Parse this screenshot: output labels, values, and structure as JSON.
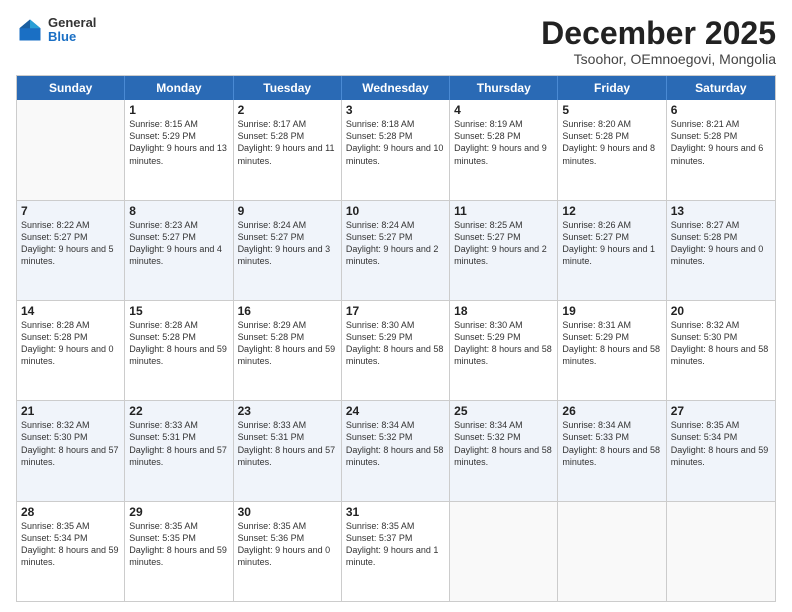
{
  "logo": {
    "general": "General",
    "blue": "Blue"
  },
  "title": "December 2025",
  "subtitle": "Tsoohor, OEmnoegovi, Mongolia",
  "header_days": [
    "Sunday",
    "Monday",
    "Tuesday",
    "Wednesday",
    "Thursday",
    "Friday",
    "Saturday"
  ],
  "weeks": [
    [
      {
        "day": "",
        "sunrise": "",
        "sunset": "",
        "daylight": ""
      },
      {
        "day": "1",
        "sunrise": "Sunrise: 8:15 AM",
        "sunset": "Sunset: 5:29 PM",
        "daylight": "Daylight: 9 hours and 13 minutes."
      },
      {
        "day": "2",
        "sunrise": "Sunrise: 8:17 AM",
        "sunset": "Sunset: 5:28 PM",
        "daylight": "Daylight: 9 hours and 11 minutes."
      },
      {
        "day": "3",
        "sunrise": "Sunrise: 8:18 AM",
        "sunset": "Sunset: 5:28 PM",
        "daylight": "Daylight: 9 hours and 10 minutes."
      },
      {
        "day": "4",
        "sunrise": "Sunrise: 8:19 AM",
        "sunset": "Sunset: 5:28 PM",
        "daylight": "Daylight: 9 hours and 9 minutes."
      },
      {
        "day": "5",
        "sunrise": "Sunrise: 8:20 AM",
        "sunset": "Sunset: 5:28 PM",
        "daylight": "Daylight: 9 hours and 8 minutes."
      },
      {
        "day": "6",
        "sunrise": "Sunrise: 8:21 AM",
        "sunset": "Sunset: 5:28 PM",
        "daylight": "Daylight: 9 hours and 6 minutes."
      }
    ],
    [
      {
        "day": "7",
        "sunrise": "Sunrise: 8:22 AM",
        "sunset": "Sunset: 5:27 PM",
        "daylight": "Daylight: 9 hours and 5 minutes."
      },
      {
        "day": "8",
        "sunrise": "Sunrise: 8:23 AM",
        "sunset": "Sunset: 5:27 PM",
        "daylight": "Daylight: 9 hours and 4 minutes."
      },
      {
        "day": "9",
        "sunrise": "Sunrise: 8:24 AM",
        "sunset": "Sunset: 5:27 PM",
        "daylight": "Daylight: 9 hours and 3 minutes."
      },
      {
        "day": "10",
        "sunrise": "Sunrise: 8:24 AM",
        "sunset": "Sunset: 5:27 PM",
        "daylight": "Daylight: 9 hours and 2 minutes."
      },
      {
        "day": "11",
        "sunrise": "Sunrise: 8:25 AM",
        "sunset": "Sunset: 5:27 PM",
        "daylight": "Daylight: 9 hours and 2 minutes."
      },
      {
        "day": "12",
        "sunrise": "Sunrise: 8:26 AM",
        "sunset": "Sunset: 5:27 PM",
        "daylight": "Daylight: 9 hours and 1 minute."
      },
      {
        "day": "13",
        "sunrise": "Sunrise: 8:27 AM",
        "sunset": "Sunset: 5:28 PM",
        "daylight": "Daylight: 9 hours and 0 minutes."
      }
    ],
    [
      {
        "day": "14",
        "sunrise": "Sunrise: 8:28 AM",
        "sunset": "Sunset: 5:28 PM",
        "daylight": "Daylight: 9 hours and 0 minutes."
      },
      {
        "day": "15",
        "sunrise": "Sunrise: 8:28 AM",
        "sunset": "Sunset: 5:28 PM",
        "daylight": "Daylight: 8 hours and 59 minutes."
      },
      {
        "day": "16",
        "sunrise": "Sunrise: 8:29 AM",
        "sunset": "Sunset: 5:28 PM",
        "daylight": "Daylight: 8 hours and 59 minutes."
      },
      {
        "day": "17",
        "sunrise": "Sunrise: 8:30 AM",
        "sunset": "Sunset: 5:29 PM",
        "daylight": "Daylight: 8 hours and 58 minutes."
      },
      {
        "day": "18",
        "sunrise": "Sunrise: 8:30 AM",
        "sunset": "Sunset: 5:29 PM",
        "daylight": "Daylight: 8 hours and 58 minutes."
      },
      {
        "day": "19",
        "sunrise": "Sunrise: 8:31 AM",
        "sunset": "Sunset: 5:29 PM",
        "daylight": "Daylight: 8 hours and 58 minutes."
      },
      {
        "day": "20",
        "sunrise": "Sunrise: 8:32 AM",
        "sunset": "Sunset: 5:30 PM",
        "daylight": "Daylight: 8 hours and 58 minutes."
      }
    ],
    [
      {
        "day": "21",
        "sunrise": "Sunrise: 8:32 AM",
        "sunset": "Sunset: 5:30 PM",
        "daylight": "Daylight: 8 hours and 57 minutes."
      },
      {
        "day": "22",
        "sunrise": "Sunrise: 8:33 AM",
        "sunset": "Sunset: 5:31 PM",
        "daylight": "Daylight: 8 hours and 57 minutes."
      },
      {
        "day": "23",
        "sunrise": "Sunrise: 8:33 AM",
        "sunset": "Sunset: 5:31 PM",
        "daylight": "Daylight: 8 hours and 57 minutes."
      },
      {
        "day": "24",
        "sunrise": "Sunrise: 8:34 AM",
        "sunset": "Sunset: 5:32 PM",
        "daylight": "Daylight: 8 hours and 58 minutes."
      },
      {
        "day": "25",
        "sunrise": "Sunrise: 8:34 AM",
        "sunset": "Sunset: 5:32 PM",
        "daylight": "Daylight: 8 hours and 58 minutes."
      },
      {
        "day": "26",
        "sunrise": "Sunrise: 8:34 AM",
        "sunset": "Sunset: 5:33 PM",
        "daylight": "Daylight: 8 hours and 58 minutes."
      },
      {
        "day": "27",
        "sunrise": "Sunrise: 8:35 AM",
        "sunset": "Sunset: 5:34 PM",
        "daylight": "Daylight: 8 hours and 59 minutes."
      }
    ],
    [
      {
        "day": "28",
        "sunrise": "Sunrise: 8:35 AM",
        "sunset": "Sunset: 5:34 PM",
        "daylight": "Daylight: 8 hours and 59 minutes."
      },
      {
        "day": "29",
        "sunrise": "Sunrise: 8:35 AM",
        "sunset": "Sunset: 5:35 PM",
        "daylight": "Daylight: 8 hours and 59 minutes."
      },
      {
        "day": "30",
        "sunrise": "Sunrise: 8:35 AM",
        "sunset": "Sunset: 5:36 PM",
        "daylight": "Daylight: 9 hours and 0 minutes."
      },
      {
        "day": "31",
        "sunrise": "Sunrise: 8:35 AM",
        "sunset": "Sunset: 5:37 PM",
        "daylight": "Daylight: 9 hours and 1 minute."
      },
      {
        "day": "",
        "sunrise": "",
        "sunset": "",
        "daylight": ""
      },
      {
        "day": "",
        "sunrise": "",
        "sunset": "",
        "daylight": ""
      },
      {
        "day": "",
        "sunrise": "",
        "sunset": "",
        "daylight": ""
      }
    ]
  ]
}
